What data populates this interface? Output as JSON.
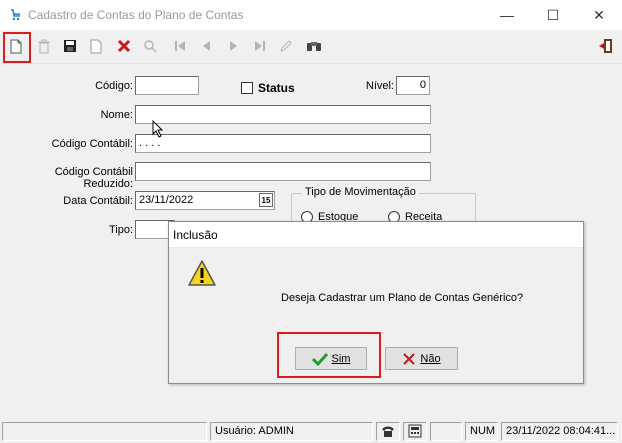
{
  "window": {
    "title": "Cadastro de Contas do Plano de Contas",
    "minimize": "—",
    "maximize": "☐",
    "close": "✕"
  },
  "form": {
    "codigo_label": "Código:",
    "codigo_value": "",
    "status_label": "Status",
    "nivel_label": "Nível:",
    "nivel_value": "0",
    "nome_label": "Nome:",
    "nome_value": "",
    "codigo_contabil_label": "Código Contábil:",
    "codigo_contabil_value": ". . . .",
    "codigo_reduzido_label": "Código Contábil Reduzido:",
    "codigo_reduzido_value": "",
    "data_contabil_label": "Data Contábil:",
    "data_contabil_value": "23/11/2022",
    "calendar_label": "15",
    "tipo_label": "Tipo:",
    "tipo_value": "",
    "movimentacao_title": "Tipo de Movimentação",
    "estoque_label": "Estoque",
    "receita_label": "Receita"
  },
  "dialog": {
    "title": "Inclusão",
    "message": "Deseja Cadastrar um Plano de Contas Genérico?",
    "yes_label": "Sim",
    "no_label": "Não"
  },
  "statusbar": {
    "user": "Usuário: ADMIN",
    "num": "NUM",
    "datetime": "23/11/2022 08:04:41..."
  },
  "colors": {
    "highlight": "#e01b1b",
    "warning": "#f5d51b"
  }
}
